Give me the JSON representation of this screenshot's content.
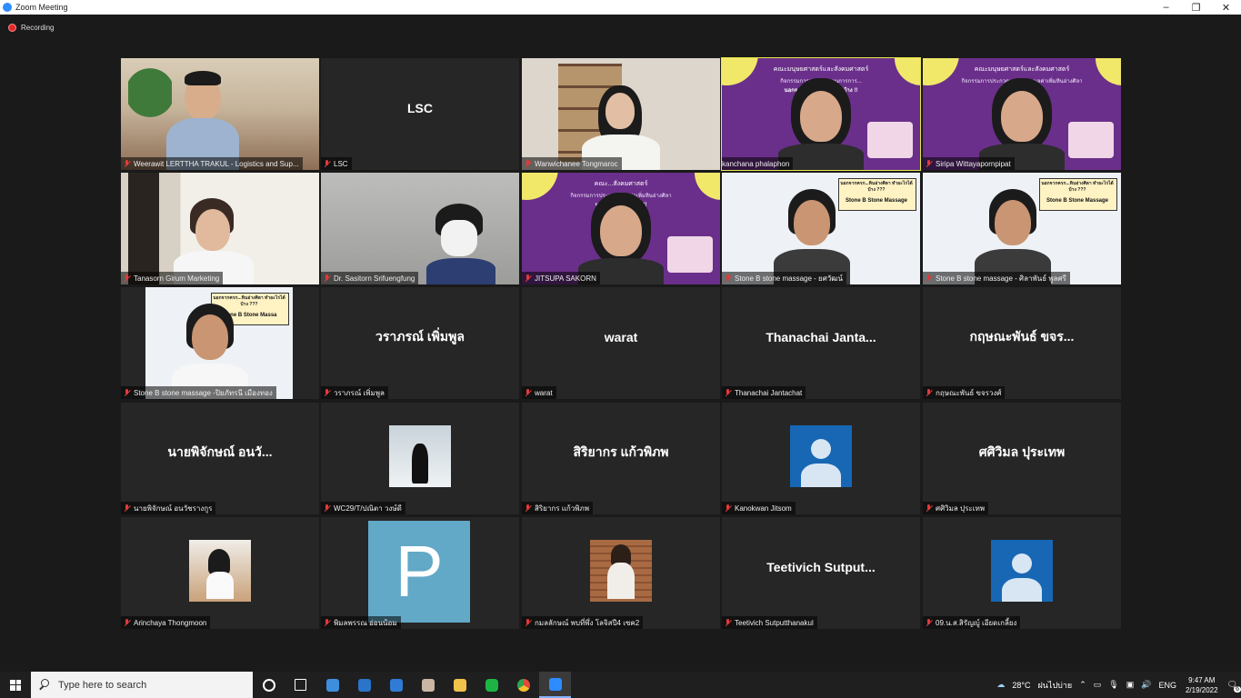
{
  "window": {
    "title": "Zoom Meeting",
    "controls": [
      "–",
      "❐",
      "✕"
    ]
  },
  "recording": {
    "label": "Recording"
  },
  "participants": [
    {
      "id": "p1",
      "name": "Weerawit LERTTHA TRAKUL - Logistics and Sup...",
      "type": "video-office"
    },
    {
      "id": "p2",
      "name": "LSC",
      "display": "LSC",
      "type": "name"
    },
    {
      "id": "p3",
      "name": "Wanwichanee Tongmaroc",
      "type": "video-bookshelf"
    },
    {
      "id": "p4",
      "name": "kanchana phalaphon",
      "type": "video-purple",
      "active": true,
      "slide_title": "คณะมนุษยศาสตร์และสังคมศาสตร์",
      "slide_line": "กิจกรรมการประกวดแผนการการ...",
      "slide_line2": "นอกจากครก...ทำอะไรได้บ้าง !!"
    },
    {
      "id": "p5",
      "name": "Siripa Wittayapornpipat",
      "type": "video-purple",
      "slide_title": "คณะมนุษยศาสตร์และสังคมศาสตร์",
      "slide_line": "กิจกรรมการประกวดแผนการ...มูลค่าเพิ่มหินอ่างศิลา",
      "slide_line2": "...ได้บ้าง !!"
    },
    {
      "id": "p6",
      "name": "Tanasorn Girum Marketing",
      "type": "video-white"
    },
    {
      "id": "p7",
      "name": "Dr. Sasitorn Srifuengfung",
      "type": "video-grey"
    },
    {
      "id": "p8",
      "name": "JITSUPA  SAKORN",
      "type": "video-purple",
      "slide_title": "คณะ...สังคมศาสตร์",
      "slide_line": "กิจกรรมการประกวด...มูลค่าเพิ่มหินอ่างศิลา",
      "slide_line2": "นอกจากคร...ได้บ้าง !!"
    },
    {
      "id": "p9",
      "name": "Stone B stone massage - ยศวัฒน์",
      "type": "video-slide",
      "slide_title": "นอกจากครก...หินอ่างศิลา ทำอะไรได้บ้าง ???",
      "slide_line": "Stone B Stone Massage"
    },
    {
      "id": "p10",
      "name": "Stone B stone massage - ศิลาพันธ์ พูลศรี",
      "type": "video-slide",
      "slide_title": "นอกจากครก...หินอ่างศิลา ทำอะไรได้บ้าง ???",
      "slide_line": "Stone B Stone Massage"
    },
    {
      "id": "p11",
      "name": "Stone B stone massage -ปิยภัทรนี  เมืองทอง",
      "type": "video-slide-small",
      "slide_title": "นอกจากครก...หินอ่างศิลา ทำอะไรได้บ้าง ???",
      "slide_line": "Stone B Stone Massa"
    },
    {
      "id": "p12",
      "name": "วราภรณ์ เพิ่มพูล",
      "display": "วราภรณ์ เพิ่มพูล",
      "type": "name"
    },
    {
      "id": "p13",
      "name": "warat",
      "display": "warat",
      "type": "name"
    },
    {
      "id": "p14",
      "name": "Thanachai Jantachat",
      "display": "Thanachai  Janta...",
      "type": "name"
    },
    {
      "id": "p15",
      "name": "กฤษณะพันธ์ ขจรวงศ์",
      "display": "กฤษณะพันธ์ ขจร...",
      "type": "name"
    },
    {
      "id": "p16",
      "name": "นายพิจักษณ์ อนวัชรางกูร",
      "display": "นายพิจักษณ์ อนวั...",
      "type": "name"
    },
    {
      "id": "p17",
      "name": "WC29/T/ปณิตา วงษ์ดี",
      "type": "photo-small"
    },
    {
      "id": "p18",
      "name": "สิริยากร แก้วพิภพ",
      "display": "สิริยากร แก้วพิภพ",
      "type": "name"
    },
    {
      "id": "p19",
      "name": "Kanokwan Jitsom",
      "type": "avatar"
    },
    {
      "id": "p20",
      "name": "ศศิวิมล ปุระเทพ",
      "display": "ศศิวิมล ปุระเทพ",
      "type": "name"
    },
    {
      "id": "p21",
      "name": "Arinchaya Thongmoon",
      "type": "photo-small2"
    },
    {
      "id": "p22",
      "name": "พิมลพรรณ อ่อนน้อม",
      "type": "letter",
      "letter": "P"
    },
    {
      "id": "p23",
      "name": "กมลลักษณ์ พบที่พึ่ง โลจิสปี4 เซค2",
      "type": "photo-small3"
    },
    {
      "id": "p24",
      "name": "Teetivich Sutputthanakul",
      "display": "Teetivich  Sutput...",
      "type": "name"
    },
    {
      "id": "p25",
      "name": "09.น.ส.สิรัญญู์ เอียดเกลี้ยง",
      "type": "avatar"
    }
  ],
  "taskbar": {
    "search_placeholder": "Type here to search",
    "apps": [
      {
        "name": "task-view-icon",
        "color": "#ffffff"
      },
      {
        "name": "widgets-icon",
        "color": "#ffffff"
      },
      {
        "name": "photos-icon",
        "color": "#3e8ede"
      },
      {
        "name": "store-icon",
        "color": "#2a74c9"
      },
      {
        "name": "mail-icon",
        "color": "#2f7bd6"
      },
      {
        "name": "paint-icon",
        "color": "#c9b6a3"
      },
      {
        "name": "explorer-icon",
        "color": "#f1c24a"
      },
      {
        "name": "line-icon",
        "color": "#1db446"
      },
      {
        "name": "chrome-icon",
        "color": "#e24b3b"
      },
      {
        "name": "zoom-icon",
        "color": "#2d8cff"
      }
    ],
    "weather": "28°C",
    "weather_label": "ฝนไปบ่าย",
    "lang": "ENG",
    "time": "9:47 AM",
    "date": "2/19/2022",
    "notifications": "6"
  }
}
